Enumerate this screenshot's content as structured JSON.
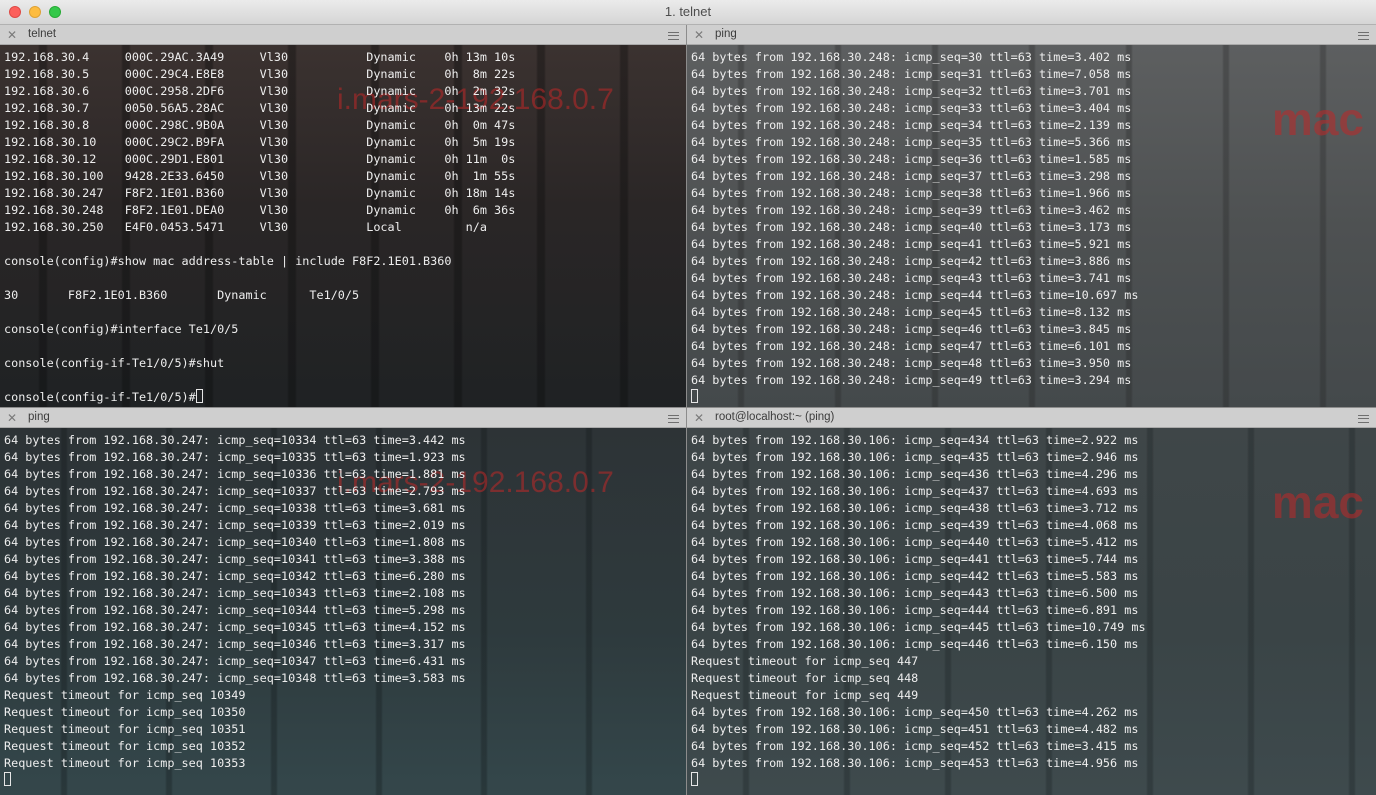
{
  "window": {
    "title": "1. telnet"
  },
  "panes": [
    {
      "tab_title": "telnet",
      "watermark": "i.mars-2-192.168.0.7",
      "lines": [
        "192.168.30.4     000C.29AC.3A49     Vl30           Dynamic    0h 13m 10s",
        "192.168.30.5     000C.29C4.E8E8     Vl30           Dynamic    0h  8m 22s",
        "192.168.30.6     000C.2958.2DF6     Vl30           Dynamic    0h  2m 32s",
        "192.168.30.7     0050.56A5.28AC     Vl30           Dynamic    0h 13m 22s",
        "192.168.30.8     000C.298C.9B0A     Vl30           Dynamic    0h  0m 47s",
        "192.168.30.10    000C.29C2.B9FA     Vl30           Dynamic    0h  5m 19s",
        "192.168.30.12    000C.29D1.E801     Vl30           Dynamic    0h 11m  0s",
        "192.168.30.100   9428.2E33.6450     Vl30           Dynamic    0h  1m 55s",
        "192.168.30.247   F8F2.1E01.B360     Vl30           Dynamic    0h 18m 14s",
        "192.168.30.248   F8F2.1E01.DEA0     Vl30           Dynamic    0h  6m 36s",
        "192.168.30.250   E4F0.0453.5471     Vl30           Local         n/a",
        "",
        "console(config)#show mac address-table | include F8F2.1E01.B360",
        "",
        "30       F8F2.1E01.B360       Dynamic      Te1/0/5",
        "",
        "console(config)#interface Te1/0/5",
        "",
        "console(config-if-Te1/0/5)#shut",
        "",
        "console(config-if-Te1/0/5)#"
      ],
      "cursor_after_last": true
    },
    {
      "tab_title": "ping",
      "watermark": "mac",
      "lines": [
        "64 bytes from 192.168.30.248: icmp_seq=30 ttl=63 time=3.402 ms",
        "64 bytes from 192.168.30.248: icmp_seq=31 ttl=63 time=7.058 ms",
        "64 bytes from 192.168.30.248: icmp_seq=32 ttl=63 time=3.701 ms",
        "64 bytes from 192.168.30.248: icmp_seq=33 ttl=63 time=3.404 ms",
        "64 bytes from 192.168.30.248: icmp_seq=34 ttl=63 time=2.139 ms",
        "64 bytes from 192.168.30.248: icmp_seq=35 ttl=63 time=5.366 ms",
        "64 bytes from 192.168.30.248: icmp_seq=36 ttl=63 time=1.585 ms",
        "64 bytes from 192.168.30.248: icmp_seq=37 ttl=63 time=3.298 ms",
        "64 bytes from 192.168.30.248: icmp_seq=38 ttl=63 time=1.966 ms",
        "64 bytes from 192.168.30.248: icmp_seq=39 ttl=63 time=3.462 ms",
        "64 bytes from 192.168.30.248: icmp_seq=40 ttl=63 time=3.173 ms",
        "64 bytes from 192.168.30.248: icmp_seq=41 ttl=63 time=5.921 ms",
        "64 bytes from 192.168.30.248: icmp_seq=42 ttl=63 time=3.886 ms",
        "64 bytes from 192.168.30.248: icmp_seq=43 ttl=63 time=3.741 ms",
        "64 bytes from 192.168.30.248: icmp_seq=44 ttl=63 time=10.697 ms",
        "64 bytes from 192.168.30.248: icmp_seq=45 ttl=63 time=8.132 ms",
        "64 bytes from 192.168.30.248: icmp_seq=46 ttl=63 time=3.845 ms",
        "64 bytes from 192.168.30.248: icmp_seq=47 ttl=63 time=6.101 ms",
        "64 bytes from 192.168.30.248: icmp_seq=48 ttl=63 time=3.950 ms",
        "64 bytes from 192.168.30.248: icmp_seq=49 ttl=63 time=3.294 ms",
        ""
      ],
      "cursor_after_last": true
    },
    {
      "tab_title": "ping",
      "watermark": "i.mars-2-192.168.0.7",
      "lines": [
        "64 bytes from 192.168.30.247: icmp_seq=10334 ttl=63 time=3.442 ms",
        "64 bytes from 192.168.30.247: icmp_seq=10335 ttl=63 time=1.923 ms",
        "64 bytes from 192.168.30.247: icmp_seq=10336 ttl=63 time=1.881 ms",
        "64 bytes from 192.168.30.247: icmp_seq=10337 ttl=63 time=2.793 ms",
        "64 bytes from 192.168.30.247: icmp_seq=10338 ttl=63 time=3.681 ms",
        "64 bytes from 192.168.30.247: icmp_seq=10339 ttl=63 time=2.019 ms",
        "64 bytes from 192.168.30.247: icmp_seq=10340 ttl=63 time=1.808 ms",
        "64 bytes from 192.168.30.247: icmp_seq=10341 ttl=63 time=3.388 ms",
        "64 bytes from 192.168.30.247: icmp_seq=10342 ttl=63 time=6.280 ms",
        "64 bytes from 192.168.30.247: icmp_seq=10343 ttl=63 time=2.108 ms",
        "64 bytes from 192.168.30.247: icmp_seq=10344 ttl=63 time=5.298 ms",
        "64 bytes from 192.168.30.247: icmp_seq=10345 ttl=63 time=4.152 ms",
        "64 bytes from 192.168.30.247: icmp_seq=10346 ttl=63 time=3.317 ms",
        "64 bytes from 192.168.30.247: icmp_seq=10347 ttl=63 time=6.431 ms",
        "64 bytes from 192.168.30.247: icmp_seq=10348 ttl=63 time=3.583 ms",
        "Request timeout for icmp_seq 10349",
        "Request timeout for icmp_seq 10350",
        "Request timeout for icmp_seq 10351",
        "Request timeout for icmp_seq 10352",
        "Request timeout for icmp_seq 10353",
        ""
      ],
      "cursor_after_last": true
    },
    {
      "tab_title": "root@localhost:~ (ping)",
      "watermark": "mac",
      "lines": [
        "64 bytes from 192.168.30.106: icmp_seq=434 ttl=63 time=2.922 ms",
        "64 bytes from 192.168.30.106: icmp_seq=435 ttl=63 time=2.946 ms",
        "64 bytes from 192.168.30.106: icmp_seq=436 ttl=63 time=4.296 ms",
        "64 bytes from 192.168.30.106: icmp_seq=437 ttl=63 time=4.693 ms",
        "64 bytes from 192.168.30.106: icmp_seq=438 ttl=63 time=3.712 ms",
        "64 bytes from 192.168.30.106: icmp_seq=439 ttl=63 time=4.068 ms",
        "64 bytes from 192.168.30.106: icmp_seq=440 ttl=63 time=5.412 ms",
        "64 bytes from 192.168.30.106: icmp_seq=441 ttl=63 time=5.744 ms",
        "64 bytes from 192.168.30.106: icmp_seq=442 ttl=63 time=5.583 ms",
        "64 bytes from 192.168.30.106: icmp_seq=443 ttl=63 time=6.500 ms",
        "64 bytes from 192.168.30.106: icmp_seq=444 ttl=63 time=6.891 ms",
        "64 bytes from 192.168.30.106: icmp_seq=445 ttl=63 time=10.749 ms",
        "64 bytes from 192.168.30.106: icmp_seq=446 ttl=63 time=6.150 ms",
        "Request timeout for icmp_seq 447",
        "Request timeout for icmp_seq 448",
        "Request timeout for icmp_seq 449",
        "64 bytes from 192.168.30.106: icmp_seq=450 ttl=63 time=4.262 ms",
        "64 bytes from 192.168.30.106: icmp_seq=451 ttl=63 time=4.482 ms",
        "64 bytes from 192.168.30.106: icmp_seq=452 ttl=63 time=3.415 ms",
        "64 bytes from 192.168.30.106: icmp_seq=453 ttl=63 time=4.956 ms",
        ""
      ],
      "cursor_after_last": true
    }
  ],
  "icons": {
    "window_close": "red-close-icon",
    "window_minimize": "yellow-minimize-icon",
    "window_zoom": "green-zoom-icon",
    "pane_close": "close-icon",
    "pane_menu": "hamburger-menu-icon"
  },
  "colors": {
    "terminal_text": "#eeeeee",
    "watermark": "#be2828",
    "tab_bar": "#cfcfcf"
  }
}
